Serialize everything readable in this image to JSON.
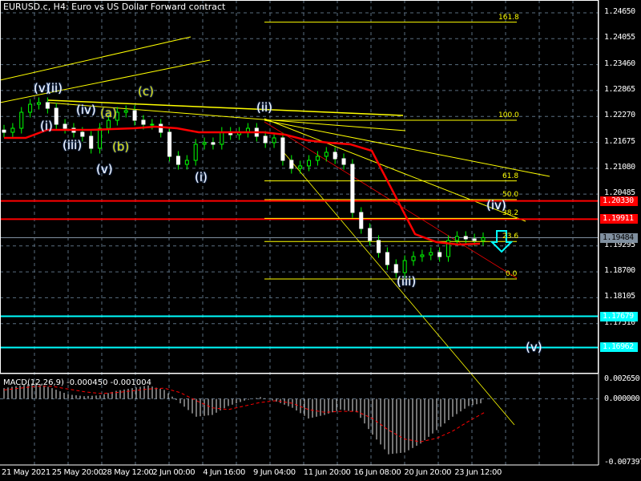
{
  "header": {
    "title": "EURUSD.c, H4:  Euro vs US Dollar Forward contract"
  },
  "colors": {
    "bull": "#00ff00",
    "bear": "#ffffff",
    "ma": "#ff0000",
    "fib": "#ffff00",
    "cyan": "#00ffff",
    "grid": "#5a6e80"
  },
  "chart_data": {
    "type": "candlestick",
    "title": "EURUSD.c, H4",
    "ylim": [
      1.165,
      1.248
    ],
    "y_ticks": [
      "1.24650",
      "1.24055",
      "1.23460",
      "1.22865",
      "1.22270",
      "1.21675",
      "1.21080",
      "1.20485",
      "1.19295",
      "1.18700",
      "1.18105",
      "1.17510"
    ],
    "x_ticks": [
      "21 May 2021",
      "25 May 20:00",
      "28 May 12:00",
      "2 Jun 00:00",
      "4 Jun 16:00",
      "9 Jun 04:00",
      "11 Jun 20:00",
      "16 Jun 08:00",
      "20 Jun 20:00",
      "23 Jun 12:00"
    ],
    "closes": [
      1.21906,
      1.21998,
      1.22366,
      1.2255,
      1.22587,
      1.22458,
      1.2209,
      1.21998,
      1.21906,
      1.21814,
      1.21538,
      1.21998,
      1.22182,
      1.22366,
      1.22403,
      1.22182,
      1.2209,
      1.2209,
      1.21906,
      1.21354,
      1.21169,
      1.21261,
      1.2163,
      1.21667,
      1.2163,
      1.21906,
      1.21851,
      1.21906,
      1.21998,
      1.21814,
      1.21667,
      1.21777,
      1.21261,
      1.21077,
      1.21133,
      1.21261,
      1.21354,
      1.21446,
      1.21298,
      1.21169,
      1.20064,
      1.19696,
      1.1942,
      1.19143,
      1.18867,
      1.18683,
      1.18959,
      1.19051,
      1.19088,
      1.19143,
      1.19051,
      1.1942,
      1.19512,
      1.19457,
      1.1942,
      1.19484
    ],
    "ma": [
      1.21777,
      1.21777,
      1.21961,
      1.21961,
      1.21961,
      1.2198,
      1.21998,
      1.22035,
      1.21998,
      1.21906,
      1.21906,
      1.21906,
      1.21906,
      1.21851,
      1.21722,
      1.21667,
      1.2163,
      1.21482,
      1.20525,
      1.19567,
      1.19383,
      1.19328,
      1.19346
    ],
    "levels": [
      {
        "price": "1.20330",
        "color": "#ff0000",
        "text_color": "#000000"
      },
      {
        "price": "1.19911",
        "color": "#ff0000",
        "text_color": "#000000"
      },
      {
        "price": "1.19484",
        "color": "#8090a0",
        "text_color": "#000000"
      },
      {
        "price": "1.17679",
        "color": "#00ffff",
        "text_color": "#000000"
      },
      {
        "price": "1.16962",
        "color": "#00ffff",
        "text_color": "#000000"
      }
    ],
    "fibonacci": {
      "low": 1.18536,
      "high": 1.22182,
      "levels": [
        "161.8",
        "100.0",
        "61.8",
        "50.0",
        "38.2",
        "23.6",
        "0.0"
      ]
    },
    "waves": [
      "(v)",
      "(ii)",
      "(i)",
      "(iii)",
      "(iv)",
      "(a)",
      "(b)",
      "(v)",
      "(c)",
      "(i)",
      "(ii)",
      "(iii)",
      "(iv)",
      "(v)"
    ],
    "macd": {
      "label": "MACD(12,26,9) -0.000450 -0.001004",
      "y_ticks": [
        "0.002650",
        "0.000000",
        "-0.007397"
      ],
      "ylim": [
        -0.007397,
        0.00265
      ],
      "histogram": [
        0.0012,
        0.0015,
        0.0018,
        0.0012,
        0.0005,
        0.0003,
        0.0004,
        0.0009,
        0.0012,
        0.0015,
        0.001,
        -0.0005,
        -0.002,
        -0.0018,
        -0.0008,
        -0.0002,
        0.0002,
        -0.0003,
        -0.001,
        -0.0022,
        -0.0018,
        -0.0012,
        -0.0015,
        -0.004,
        -0.0062,
        -0.006,
        -0.005,
        -0.0035,
        -0.002,
        -0.0008,
        -0.0004
      ],
      "signal": [
        0.001,
        0.0012,
        0.0014,
        0.0014,
        0.0011,
        0.0008,
        0.0006,
        0.0007,
        0.0009,
        0.0011,
        0.0012,
        0.0007,
        -0.0002,
        -0.001,
        -0.0012,
        -0.0008,
        -0.0004,
        -0.0002,
        -0.0005,
        -0.0012,
        -0.0015,
        -0.0014,
        -0.0014,
        -0.0022,
        -0.0035,
        -0.0045,
        -0.0048,
        -0.0044,
        -0.0036,
        -0.0025,
        -0.0015
      ]
    }
  }
}
